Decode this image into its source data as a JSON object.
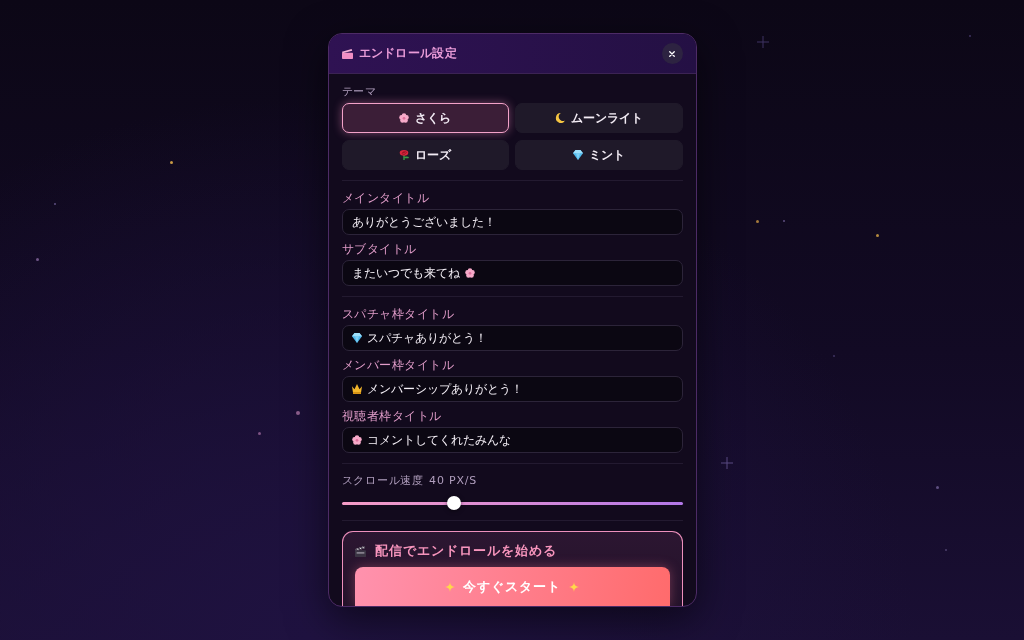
{
  "dialog": {
    "title": "エンドロール設定"
  },
  "theme": {
    "label": "テーマ",
    "options": [
      {
        "label": "さくら",
        "selected": true
      },
      {
        "label": "ムーンライト",
        "selected": false
      },
      {
        "label": "ローズ",
        "selected": false
      },
      {
        "label": "ミント",
        "selected": false
      }
    ]
  },
  "title_fields": [
    {
      "label": "メインタイトル",
      "value": "ありがとうございました！"
    },
    {
      "label": "サブタイトル",
      "value": "またいつでも来てね"
    }
  ],
  "frame_fields": [
    {
      "label": "スパチャ枠タイトル",
      "value": "スパチャありがとう！"
    },
    {
      "label": "メンバー枠タイトル",
      "value": "メンバーシップありがとう！"
    },
    {
      "label": "視聴者枠タイトル",
      "value": "コメントしてくれたみんな"
    }
  ],
  "scroll_speed": {
    "label": "スクロール速度",
    "reading": "40 PX/S",
    "level": 0.33
  },
  "stream_card": {
    "title": "配信でエンドロールを始める",
    "start_button": {
      "label": "今すぐスタート"
    }
  }
}
